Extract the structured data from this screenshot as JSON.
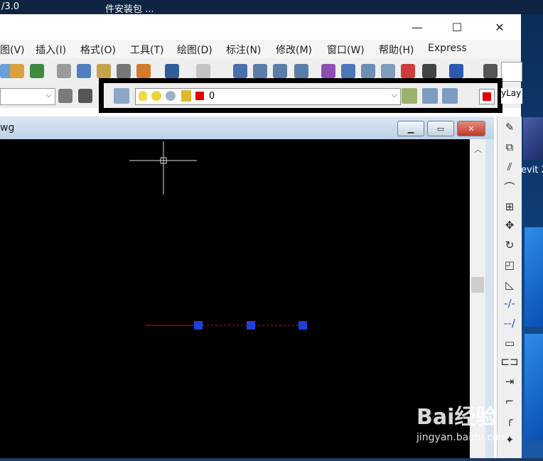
{
  "desktop": {
    "top_text_left": "/3.0",
    "top_text_mid": "件安装包 ...",
    "desktop_icon_label": "evit 2"
  },
  "window": {
    "minimize_symbol": "—",
    "maximize_symbol": "☐",
    "close_symbol": "✕"
  },
  "menu": {
    "items": [
      "图(V)",
      "插入(I)",
      "格式(O)",
      "工具(T)",
      "绘图(D)",
      "标注(N)",
      "修改(M)",
      "窗口(W)",
      "帮助(H)",
      "Express"
    ]
  },
  "layer_toolbar": {
    "current_layer": "0",
    "color_swatch": "#e00000",
    "bylayer_text": "yLay"
  },
  "drawing_window": {
    "title_fragment": "wg"
  },
  "canvas": {
    "background": "#000000",
    "line_color": "#c00000",
    "grip_color": "#1f3fdc"
  },
  "watermark": {
    "logo": "Bai经验",
    "url": "jingyan.baidu.com"
  },
  "right_toolbar": {
    "icons": [
      "erase-icon",
      "copy-icon",
      "mirror-icon",
      "offset-icon",
      "array-icon",
      "move-icon",
      "rotate-icon",
      "scale-icon",
      "stretch-icon",
      "trim-icon",
      "extend-icon",
      "break-icon",
      "break-at-point-icon",
      "join-icon",
      "chamfer-icon",
      "fillet-icon",
      "explode-icon"
    ]
  }
}
